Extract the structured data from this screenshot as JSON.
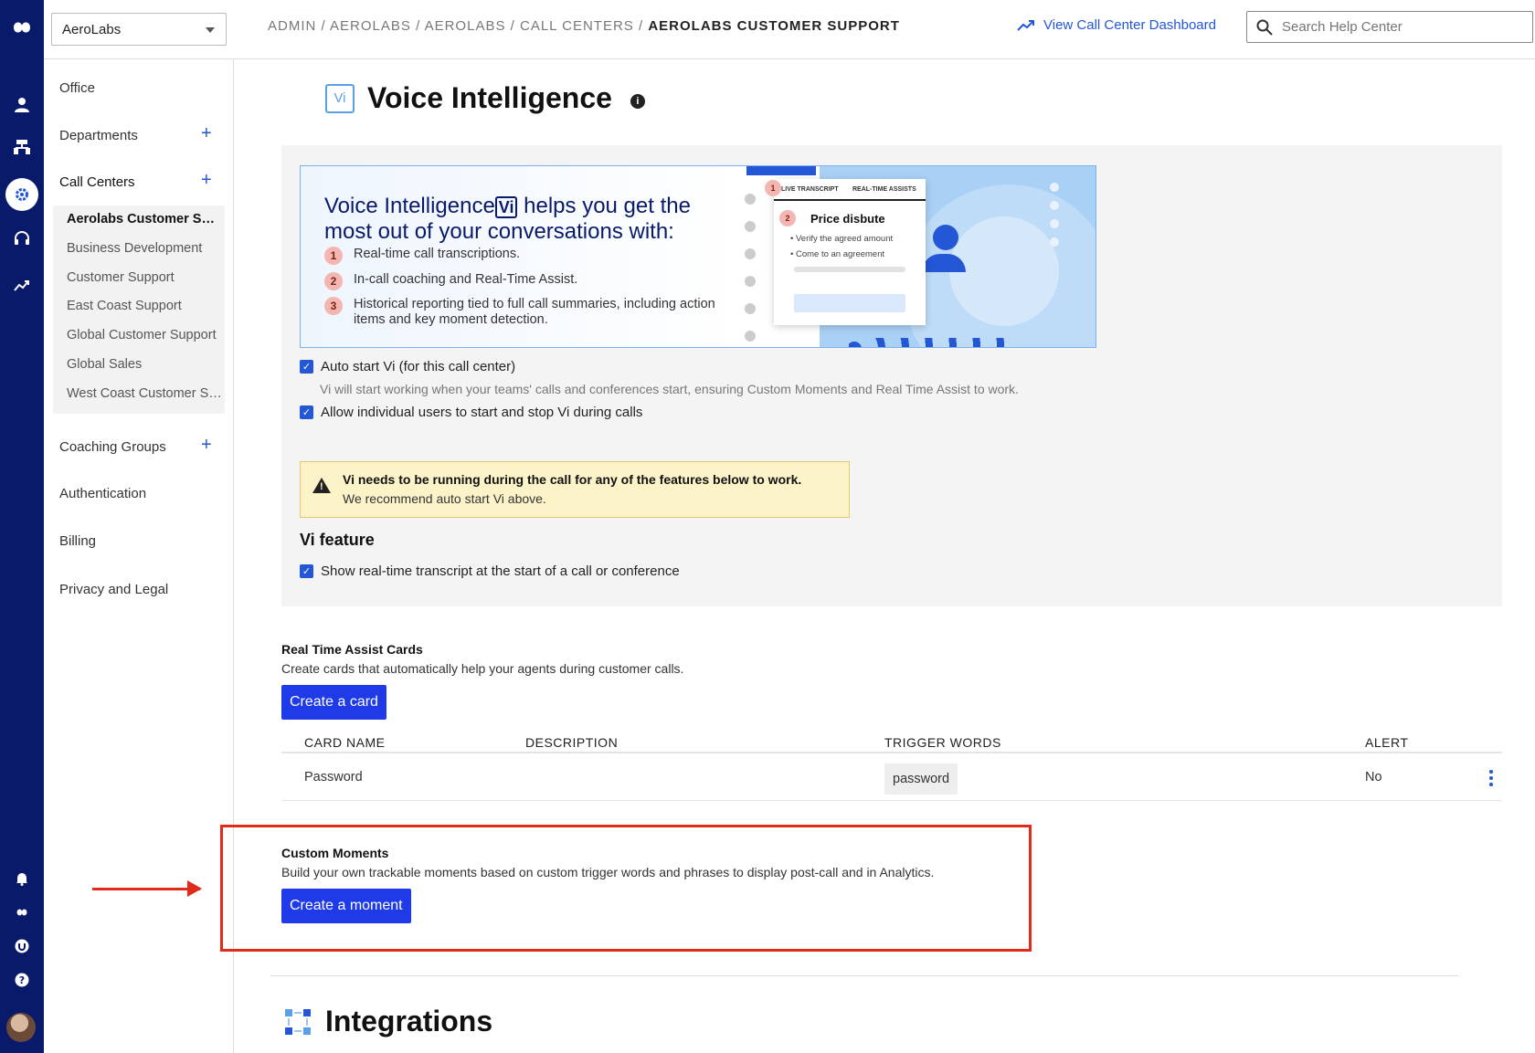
{
  "org_select": {
    "value": "AeroLabs"
  },
  "breadcrumb": {
    "items": [
      "ADMIN",
      "AEROLABS",
      "AEROLABS",
      "CALL CENTERS"
    ],
    "separator": " / ",
    "current": "AEROLABS CUSTOMER SUPPORT"
  },
  "header": {
    "dashboard_link": "View Call Center Dashboard"
  },
  "search": {
    "placeholder": "Search Help Center"
  },
  "sidebar": {
    "office": "Office",
    "departments": "Departments",
    "call_centers": "Call Centers",
    "call_center_items": [
      "Aerolabs Customer Support",
      "Business Development",
      "Customer Support",
      "East Coast Support",
      "Global Customer Support",
      "Global Sales",
      "West Coast Customer Support"
    ],
    "coaching_groups": "Coaching Groups",
    "authentication": "Authentication",
    "billing": "Billing",
    "privacy": "Privacy and Legal",
    "add_symbol": "+"
  },
  "page": {
    "title": "Voice Intelligence",
    "logo_text": "Vi",
    "info_symbol": "i"
  },
  "banner": {
    "heading_pre": "Voice Intelligence",
    "heading_badge": "Vi",
    "heading_post": " helps you get the most out of your conversations with:",
    "bullets": [
      {
        "num": "1",
        "text": "Real-time call transcriptions."
      },
      {
        "num": "2",
        "text": "In-call coaching and Real-Time Assist."
      },
      {
        "num": "3",
        "text": "Historical reporting tied to full call summaries, including action items and key moment detection."
      }
    ],
    "illus": {
      "tab1": "LIVE TRANSCRIPT",
      "tab2": "REAL-TIME ASSISTS",
      "badge1": "1",
      "badge2": "2",
      "card_title": "Price disbute",
      "card_items": [
        "Verify the agreed amount",
        "Come to an agreement"
      ]
    }
  },
  "settings": {
    "auto_start": {
      "label": "Auto start Vi (for this call center)",
      "checked": true
    },
    "auto_start_hint": "Vi will start working when your teams' calls and conferences start, ensuring Custom Moments and Real Time Assist to work.",
    "allow_users": {
      "label": "Allow individual users to start and stop Vi during calls",
      "checked": true
    }
  },
  "warning": {
    "line1": "Vi needs to be running during the call for any of the features below to work.",
    "line2": "We recommend auto start Vi above."
  },
  "vi_feature": {
    "heading": "Vi feature",
    "transcript": {
      "label": "Show real-time transcript at the start of a call or conference",
      "checked": true
    }
  },
  "rta": {
    "heading": "Real Time Assist Cards",
    "description": "Create cards that automatically help your agents during customer calls.",
    "button": "Create a card",
    "columns": [
      "CARD NAME",
      "DESCRIPTION",
      "TRIGGER WORDS",
      "ALERT"
    ],
    "rows": [
      {
        "name": "Password",
        "description": "",
        "trigger": "password",
        "alert": "No"
      }
    ]
  },
  "custom_moments": {
    "heading": "Custom Moments",
    "description": "Build your own trackable moments based on custom trigger words and phrases to display post-call and in Analytics.",
    "button": "Create a moment"
  },
  "integrations": {
    "title": "Integrations"
  },
  "colors": {
    "rail": "#0a1a6b",
    "accent": "#1f3be8",
    "link": "#2357d6",
    "highlight": "#e02a1a",
    "warning_bg": "#fdf3c8"
  }
}
